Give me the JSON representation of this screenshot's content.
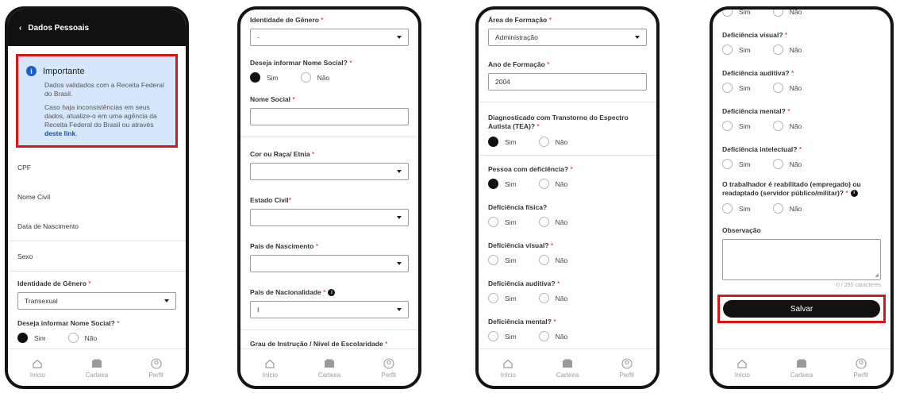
{
  "nav": {
    "home": "Início",
    "wallet": "Carteira",
    "profile": "Perfil"
  },
  "s1": {
    "title": "Dados Pessoais",
    "box_title": "Importante",
    "box_text1": "Dados validados com a Receita Federal do Brasil.",
    "box_text2": "Caso haja inconsistências em seus dados, atualize-o em uma agência da Receita Federal do Brasil ou através ",
    "box_link": "deste link",
    "box_end": ".",
    "cpf": "CPF",
    "nome_civil": "Nome Civil",
    "data_nasc": "Data de Nascimento",
    "sexo": "Sexo",
    "identidade_label": "Identidade de Gênero",
    "identidade_value": "Transexual",
    "nome_social_q": "Deseja informar Nome Social?",
    "sim": "Sim",
    "nao": "Não"
  },
  "s2": {
    "identidade_label": "Identidade de Gênero",
    "identidade_value": "-",
    "nome_social_q": "Deseja informar Nome Social?",
    "sim": "Sim",
    "nao": "Não",
    "nome_social": "Nome Social",
    "cor": "Cor ou Raça/ Etnia",
    "estado_civil": "Estado Civil",
    "pais_nasc": "País de Nascimento",
    "pais_nac": "País de Nacionalidade",
    "pais_nac_value": "I",
    "grau": "Grau de Instrução / Nível de Escolaridade"
  },
  "s3": {
    "area_label": "Área de Formação",
    "area_value": "Administração",
    "ano_label": "Ano de Formação",
    "ano_value": "2004",
    "tea": "Diagnosticado com Transtorno do Espectro Autista (TEA)?",
    "pcd": "Pessoa com deficiência?",
    "fisica": "Deficiência física?",
    "visual": "Deficiência visual?",
    "auditiva": "Deficiência auditiva?",
    "mental": "Deficiência mental?",
    "sim": "Sim",
    "nao": "Não"
  },
  "s4": {
    "visual": "Deficiência visual?",
    "auditiva": "Deficiência auditiva?",
    "mental": "Deficiência mental?",
    "intelectual": "Deficiência intelectual?",
    "reab": "O trabalhador é reabilitado (empregado) ou readaptado (servidor público/militar)?",
    "obs": "Observação",
    "counter": "0 / 255 caracteres",
    "salvar": "Salvar",
    "sim": "Sim",
    "nao": "Não"
  }
}
